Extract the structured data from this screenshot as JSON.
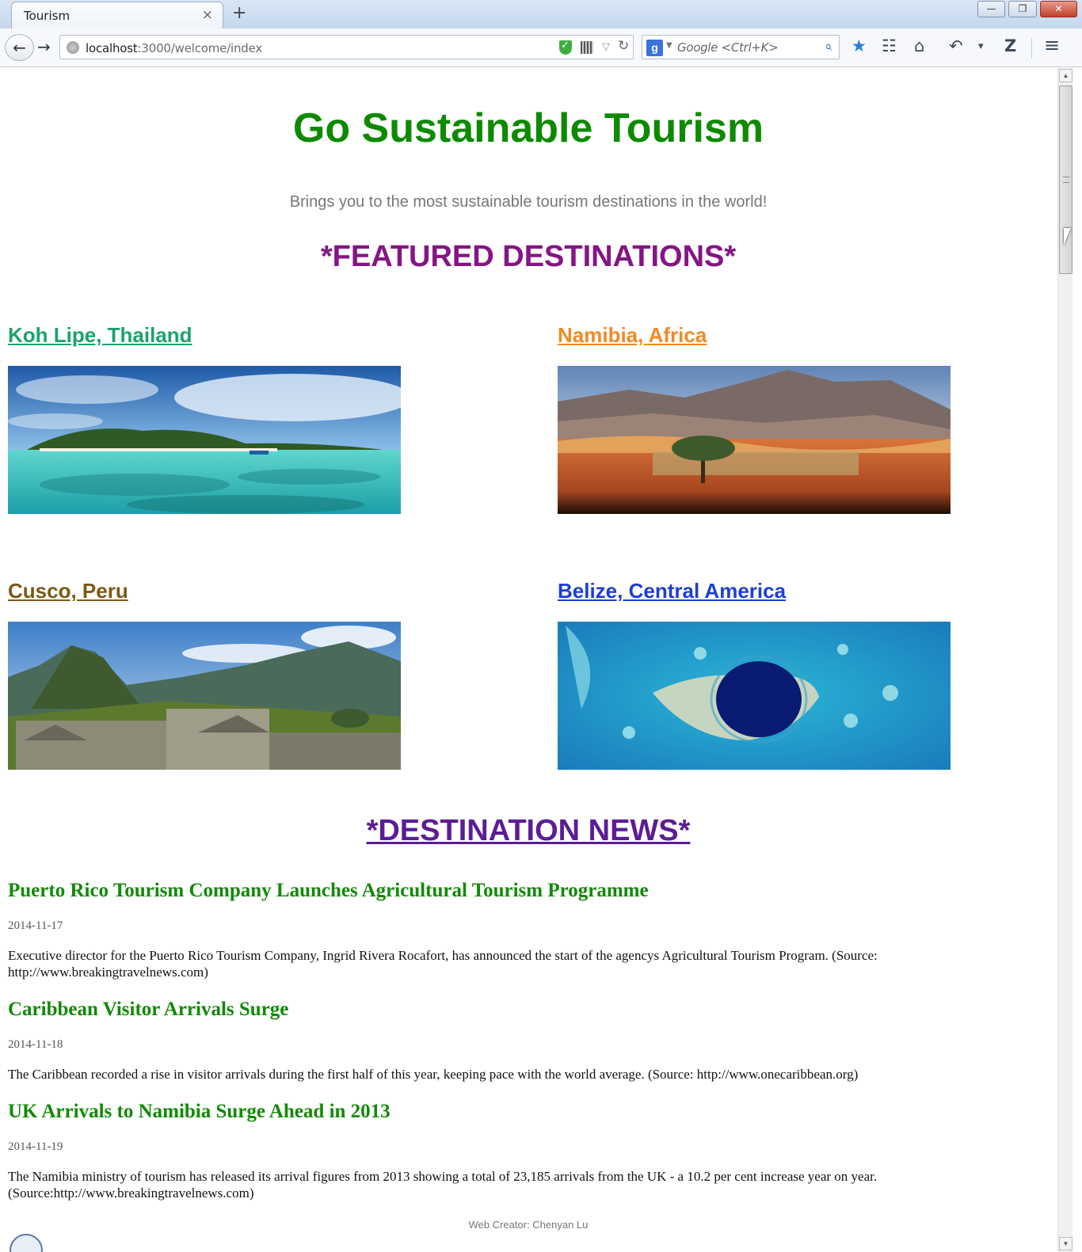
{
  "browser": {
    "tab_title": "Tourism",
    "tab_close": "×",
    "new_tab": "+",
    "window_controls": {
      "minimize": "—",
      "restore": "❐",
      "close": "✕"
    },
    "url_host": "localhost",
    "url_rest": ":3000/welcome/index",
    "search_engine_letter": "g",
    "search_placeholder": "Google <Ctrl+K>",
    "icons": {
      "back": "arrow-left",
      "forward": "arrow-right",
      "reload": "reload",
      "bookmark": "star",
      "bookmarks_list": "clipboard",
      "home": "home",
      "undo": "undo",
      "zotero": "Z",
      "menu": "hamburger"
    }
  },
  "page": {
    "title": "Go Sustainable Tourism",
    "tagline": "Brings you to the most sustainable tourism destinations in the world!",
    "featured_heading": "*FEATURED DESTINATIONS*",
    "destinations": [
      {
        "name": "Koh Lipe, Thailand",
        "color": "#1da36a",
        "image": "tropical-island-lagoon"
      },
      {
        "name": "Namibia, Africa",
        "color": "#f08a26",
        "image": "desert-mountains-acacia"
      },
      {
        "name": "Cusco, Peru",
        "color": "#7a5a14",
        "image": "machu-picchu-ruins"
      },
      {
        "name": "Belize, Central America",
        "color": "#1c3fd6",
        "image": "great-blue-hole-reef"
      }
    ],
    "news_heading": "*DESTINATION NEWS*",
    "news": [
      {
        "headline": "Puerto Rico Tourism Company Launches Agricultural Tourism Programme",
        "date": "2014-11-17",
        "summary": "Executive director for the Puerto Rico Tourism Company, Ingrid Rivera Rocafort, has announced the start of the agencys Agricultural Tourism Program. (Source: http://www.breakingtravelnews.com)"
      },
      {
        "headline": "Caribbean Visitor Arrivals Surge",
        "date": "2014-11-18",
        "summary": "The Caribbean recorded a rise in visitor arrivals during the first half of this year, keeping pace with the world average. (Source: http://www.onecaribbean.org)"
      },
      {
        "headline": "UK Arrivals to Namibia Surge Ahead in 2013",
        "date": "2014-11-19",
        "summary": "The Namibia ministry of tourism has released its arrival figures from 2013 showing a total of 23,185 arrivals from the UK - a 10.2 per cent increase year on year. (Source:http://www.breakingtravelnews.com)"
      }
    ],
    "footer": "Web Creator: Chenyan Lu"
  },
  "colors": {
    "title_green": "#0d8a00",
    "featured_purple": "#851585",
    "news_purple": "#5b1d95",
    "headline_green": "#118a06"
  }
}
